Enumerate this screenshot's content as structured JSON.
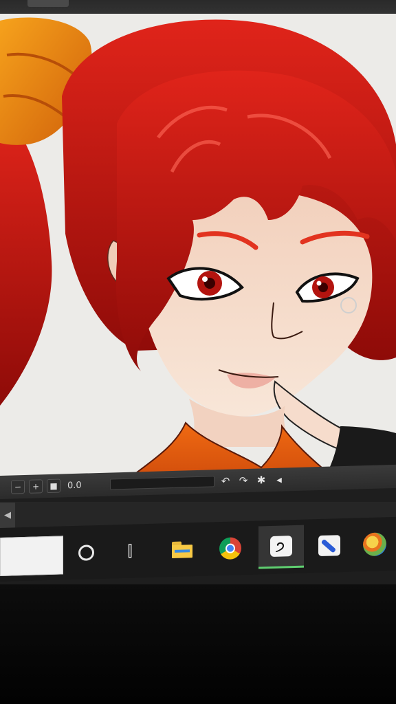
{
  "app": {
    "name": "Clip Studio Paint"
  },
  "status_bar": {
    "zoom_out_icon": "zoom-out-icon",
    "zoom_in_icon": "zoom-in-icon",
    "fit_icon": "fit-screen-icon",
    "rotation_value": "0.0",
    "rotate_left_icon": "rotate-left-icon",
    "rotate_right_icon": "rotate-right-icon",
    "reset_rotation_icon": "reset-rotation-icon",
    "collapse_icon": "collapse-left-icon"
  },
  "taskbar": {
    "apps": [
      {
        "name": "cortana-icon",
        "active": false
      },
      {
        "name": "task-view-icon",
        "active": false
      },
      {
        "name": "file-explorer-icon",
        "active": false
      },
      {
        "name": "chrome-icon",
        "active": false
      },
      {
        "name": "clip-studio-icon",
        "active": true
      },
      {
        "name": "sketchbook-icon",
        "active": false
      },
      {
        "name": "paint-app-icon",
        "active": false
      }
    ]
  },
  "colors": {
    "hair": "#c8140f",
    "bun": "#f08a10",
    "skin": "#f6dcc9",
    "canvas_bg": "#ecebe8",
    "taskbar_active": "#5fcf70"
  }
}
